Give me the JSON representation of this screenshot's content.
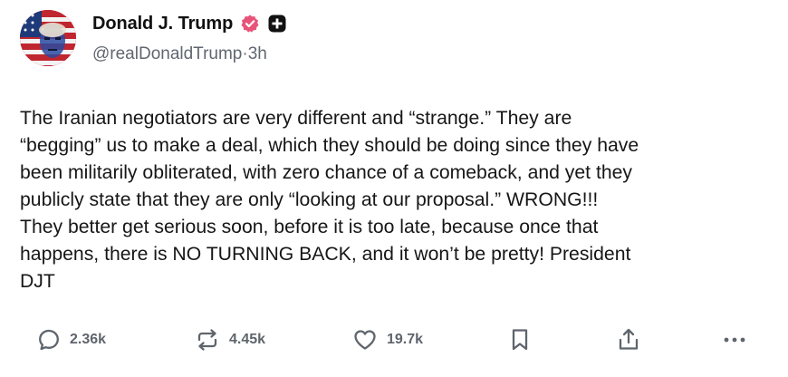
{
  "author": {
    "display_name": "Donald J. Trump",
    "handle": "@realDonaldTrump",
    "separator": " · ",
    "time_ago": "3h",
    "verified_color": "#e8537a"
  },
  "post": {
    "text": "The Iranian negotiators are very different and “strange.” They are\n“begging” us to make a deal, which they should be doing since they have\nbeen militarily obliterated, with zero chance of a comeback, and yet they\npublicly state that they are only “looking at our proposal.” WRONG!!!\nThey better get serious soon, before it is too late, because once that\nhappens, there is NO TURNING BACK, and it won’t be pretty! President\nDJT"
  },
  "actions": {
    "replies": "2.36k",
    "reblogs": "4.45k",
    "likes": "19.7k",
    "icons": [
      "reply-icon",
      "repost-icon",
      "heart-icon",
      "bookmark-icon",
      "share-icon",
      "more-icon"
    ]
  }
}
